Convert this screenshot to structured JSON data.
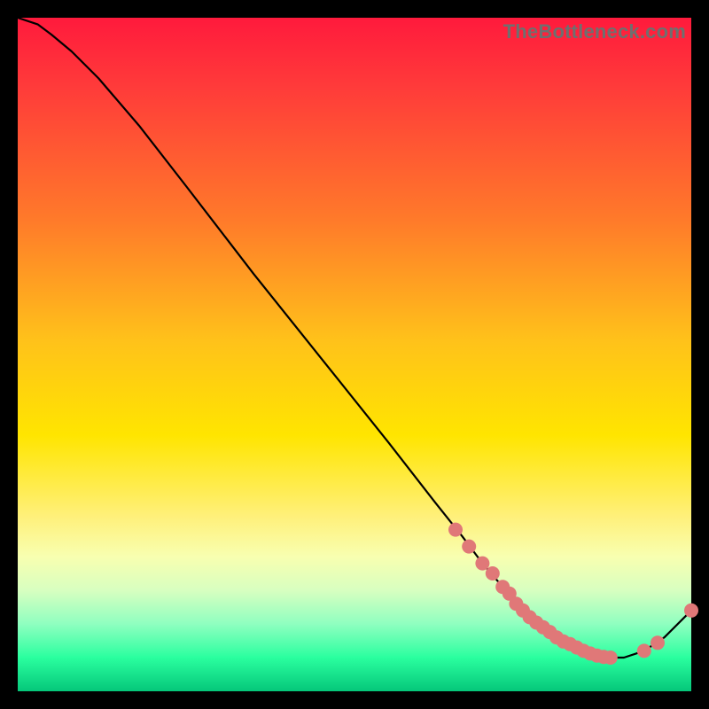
{
  "watermark": "TheBottleneck.com",
  "chart_data": {
    "type": "line",
    "title": "",
    "xlabel": "",
    "ylabel": "",
    "xlim": [
      0,
      100
    ],
    "ylim": [
      0,
      100
    ],
    "series": [
      {
        "name": "curve",
        "x": [
          0,
          3,
          5,
          8,
          12,
          18,
          25,
          35,
          45,
          55,
          62,
          66,
          69,
          72,
          74,
          76,
          78,
          80,
          82,
          84,
          86,
          88,
          90,
          93,
          96,
          100
        ],
        "y": [
          100,
          99,
          97.5,
          95,
          91,
          84,
          75,
          62,
          49.5,
          37,
          28,
          23,
          19,
          15.5,
          13,
          11,
          9.5,
          8,
          7,
          6,
          5.3,
          5,
          5,
          6,
          8,
          12
        ]
      }
    ],
    "markers": {
      "name": "highlight-points",
      "color": "#e07878",
      "x": [
        65,
        67,
        69,
        70.5,
        72,
        73,
        74,
        75,
        76,
        77,
        78,
        79,
        80,
        81,
        82,
        83,
        84,
        85,
        86,
        87,
        88,
        93,
        95,
        100
      ],
      "y": [
        24,
        21.5,
        19,
        17.5,
        15.5,
        14.5,
        13,
        12,
        11,
        10.2,
        9.5,
        8.8,
        8,
        7.4,
        7,
        6.5,
        6,
        5.6,
        5.3,
        5.1,
        5,
        6,
        7.2,
        12
      ]
    }
  }
}
